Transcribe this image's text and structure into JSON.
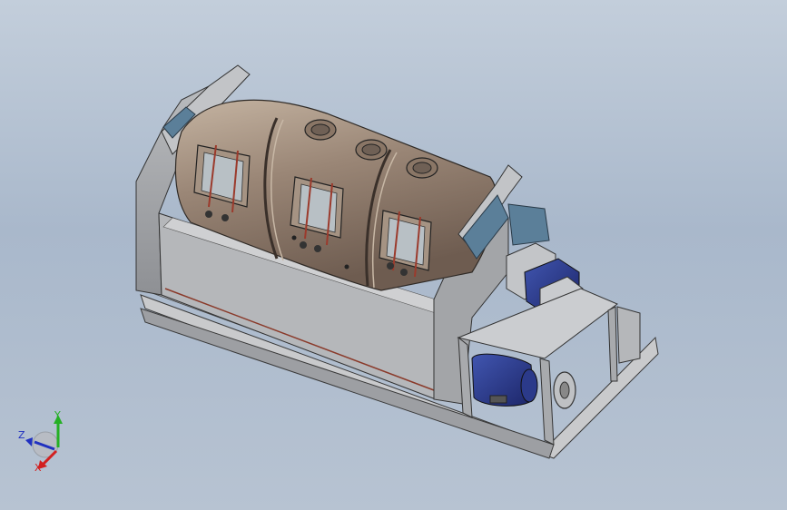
{
  "viewport": {
    "background_top": "#c3cedb",
    "background_bottom": "#b7c3d2"
  },
  "model": {
    "drum_color": "#9a8676",
    "frame_color": "#a7a9ac",
    "blue_panel_color": "#5b7f99",
    "motor_color": "#2b3a8a",
    "hinge_color": "#9b3a2c"
  },
  "triad": {
    "x_label": "X",
    "y_label": "Y",
    "z_label": "Z",
    "x_color": "#d22020",
    "y_color": "#25b025",
    "z_color": "#2030c0"
  }
}
